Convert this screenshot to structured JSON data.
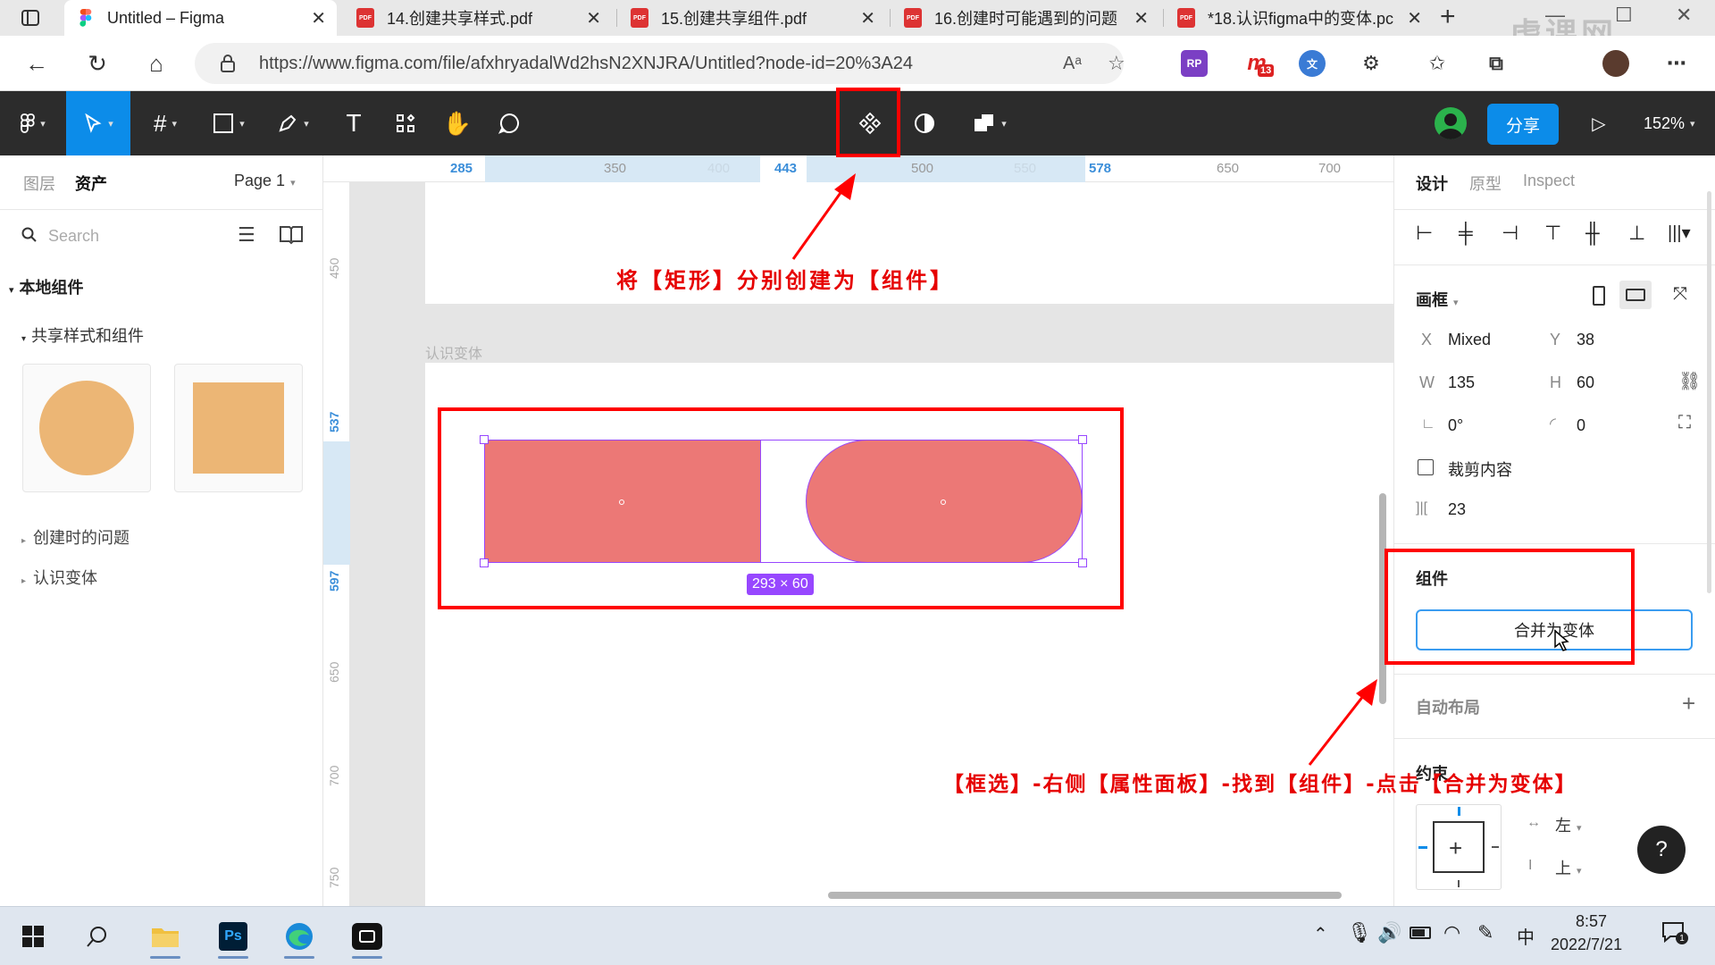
{
  "browser": {
    "tabs": [
      {
        "title": "Untitled – Figma",
        "active": true
      },
      {
        "title": "14.创建共享样式.pdf"
      },
      {
        "title": "15.创建共享组件.pdf"
      },
      {
        "title": "16.创建时可能遇到的问题"
      },
      {
        "title": "*18.认识figma中的变体.pc"
      }
    ],
    "url": "https://www.figma.com/file/afxhryadalWd2hsN2XNJRA/Untitled?node-id=20%3A24",
    "extension_badge": "13",
    "watermark": "虎课网"
  },
  "figma_toolbar": {
    "share_label": "分享",
    "zoom": "152%"
  },
  "left_panel": {
    "tab_layers": "图层",
    "tab_assets": "资产",
    "page": "Page 1",
    "search_placeholder": "Search",
    "local_components": "本地组件",
    "group_shared": "共享样式和组件",
    "group_problems": "创建时的问题",
    "group_variants": "认识变体"
  },
  "ruler_top": {
    "ticks": [
      "285",
      "350",
      "400",
      "443",
      "500",
      "550",
      "578",
      "650",
      "700"
    ]
  },
  "ruler_left": {
    "ticks": [
      "450",
      "537",
      "597",
      "650",
      "700",
      "750"
    ]
  },
  "canvas": {
    "frame_label": "认识变体",
    "size_badge": "293 × 60"
  },
  "right_panel": {
    "tab_design": "设计",
    "tab_prototype": "原型",
    "tab_inspect": "Inspect",
    "frame_title": "画框",
    "x_label": "X",
    "x_value": "Mixed",
    "y_label": "Y",
    "y_value": "38",
    "w_label": "W",
    "w_value": "135",
    "h_label": "H",
    "h_value": "60",
    "rotation": "0°",
    "radius": "0",
    "clip_content": "裁剪内容",
    "spacing": "23",
    "component_title": "组件",
    "combine_button": "合并为变体",
    "auto_layout": "自动布局",
    "constraints": "约束",
    "constraint_h": "左",
    "constraint_v": "上",
    "help": "?"
  },
  "annotations": {
    "top": "将【矩形】分别创建为【组件】",
    "bottom": "【框选】-右侧【属性面板】-找到【组件】-点击【合并为变体】"
  },
  "taskbar": {
    "ime": "中",
    "time": "8:57",
    "date": "2022/7/21",
    "notification_count": "1"
  },
  "colors": {
    "figma_dark": "#2c2c2c",
    "accent_blue": "#0c8ce9",
    "shape_fill": "#ec7876",
    "asset_fill": "#ecb675",
    "selection": "#9747ff",
    "annotation_red": "#e60000"
  }
}
